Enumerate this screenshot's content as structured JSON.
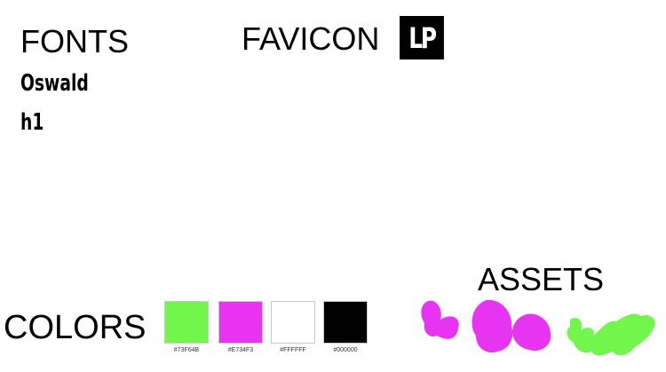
{
  "sections": {
    "fonts": "FONTS",
    "favicon": "FAVICON",
    "colors": "COLORS",
    "assets": "ASSETS"
  },
  "favicon_logo_text": "LP",
  "font_samples": [
    "Oswald",
    "h1"
  ],
  "colors": [
    {
      "hex": "#73F64B",
      "label": "#73F64B"
    },
    {
      "hex": "#E734F3",
      "label": "#E734F3"
    },
    {
      "hex": "#FFFFFF",
      "label": "#FFFFFF"
    },
    {
      "hex": "#000000",
      "label": "#000000"
    }
  ],
  "asset_colors": {
    "magenta": "#E734F3",
    "green": "#73F64B"
  }
}
